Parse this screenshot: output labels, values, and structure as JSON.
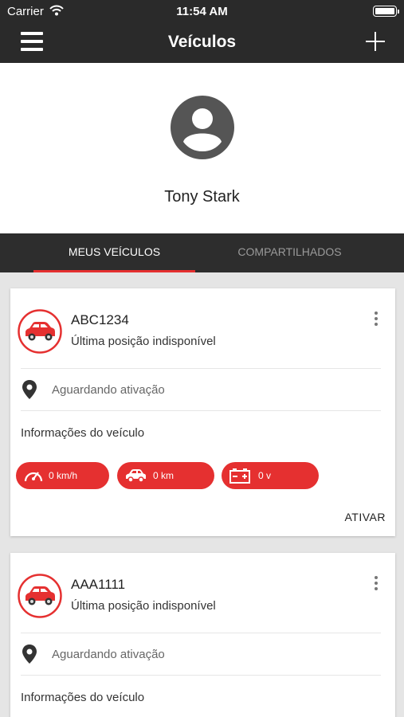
{
  "statusbar": {
    "carrier": "Carrier",
    "time": "11:54 AM"
  },
  "navbar": {
    "title": "Veículos",
    "menu_icon": "hamburger-menu-icon",
    "add_icon": "plus-icon"
  },
  "profile": {
    "name": "Tony Stark",
    "avatar_icon": "user-avatar-icon"
  },
  "tabs": [
    {
      "label": "MEUS VEÍCULOS",
      "selected": true
    },
    {
      "label": "COMPARTILHADOS",
      "selected": false
    }
  ],
  "colors": {
    "accent": "#e53030",
    "navbar": "#2a2a2a",
    "tab_bar": "#2d2d2d",
    "background": "#e5e5e5"
  },
  "vehicles": [
    {
      "plate": "ABC1234",
      "last_position": "Última posição indisponível",
      "status": "Aguardando ativação",
      "info_title": "Informações do veículo",
      "speed": "0 km/h",
      "odometer": "0 km",
      "battery": "0 v",
      "action": "ATIVAR"
    },
    {
      "plate": "AAA1111",
      "last_position": "Última posição indisponível",
      "status": "Aguardando ativação",
      "info_title": "Informações do veículo"
    }
  ]
}
